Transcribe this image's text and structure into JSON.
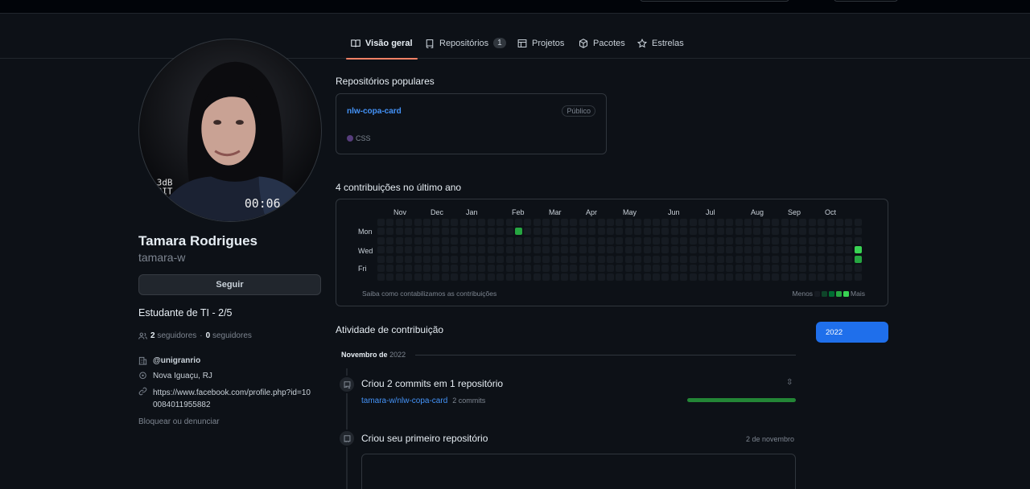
{
  "tabs": [
    {
      "label": "Visão geral",
      "icon": "book-icon",
      "active": true
    },
    {
      "label": "Repositórios",
      "icon": "repo-icon",
      "count": "1"
    },
    {
      "label": "Projetos",
      "icon": "table-icon"
    },
    {
      "label": "Pacotes",
      "icon": "package-icon"
    },
    {
      "label": "Estrelas",
      "icon": "star-icon"
    }
  ],
  "profile": {
    "avatar_overlay": {
      "left_top": "3dB",
      "left_bottom": "BIT",
      "timer": "00:06"
    },
    "name": "Tamara Rodrigues",
    "login": "tamara-w",
    "follow_label": "Seguir",
    "bio": "Estudante de TI - 2/5",
    "followers_count": "2",
    "followers_label": "seguidores",
    "separator": "·",
    "following_count": "0",
    "following_label": "seguidores",
    "org": "@unigranrio",
    "location": "Nova Iguaçu, RJ",
    "website": "https://www.facebook.com/profile.php?id=100084011955882",
    "block_label": "Bloquear ou denunciar"
  },
  "popular": {
    "title": "Repositórios populares",
    "repo_name": "nlw-copa-card",
    "visibility": "Público",
    "language": "CSS",
    "language_color": "#563d7c"
  },
  "contributions": {
    "title": "4 contribuições no último ano",
    "months": [
      "Nov",
      "Dec",
      "Jan",
      "Feb",
      "Mar",
      "Apr",
      "May",
      "Jun",
      "Jul",
      "Aug",
      "Sep",
      "Oct"
    ],
    "day_labels": [
      "Mon",
      "Wed",
      "Fri"
    ],
    "weeks": 53,
    "active_cells": [
      {
        "week": 15,
        "day": 1,
        "level": 3
      },
      {
        "week": 52,
        "day": 3,
        "level": 4
      },
      {
        "week": 52,
        "day": 4,
        "level": 3
      }
    ],
    "footer_link": "Saiba como contabilizamos as contribuições",
    "legend_less": "Menos",
    "legend_more": "Mais",
    "level_colors": [
      "#161b22",
      "#0e4429",
      "#006d32",
      "#26a641",
      "#39d353"
    ]
  },
  "activity": {
    "title": "Atividade de contribuição",
    "year": "2022",
    "month_label": "Novembro",
    "month_suffix": "de",
    "month_year": "2022",
    "commits_title": "Criou 2 commits em 1 repositório",
    "commit_repo": "tamara-w/nlw-copa-card",
    "commit_count": "2 commits",
    "created_title": "Criou seu primeiro repositório",
    "created_date": "2 de novembro"
  }
}
